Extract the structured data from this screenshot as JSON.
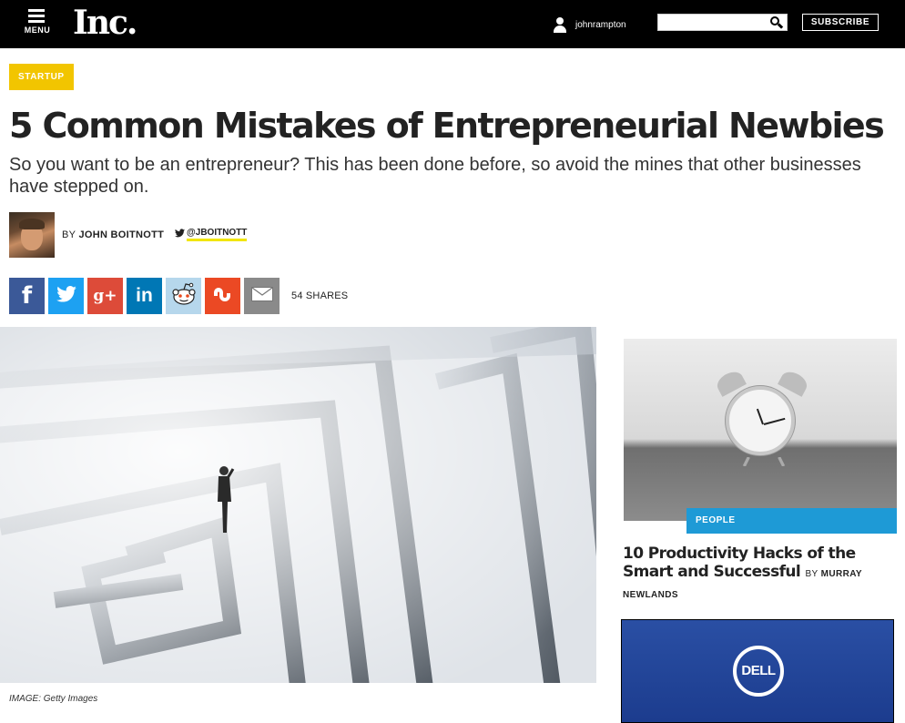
{
  "header": {
    "menu_label": "MENU",
    "logo_text": "Inc.",
    "username": "johnrampton",
    "search_placeholder": "",
    "subscribe_label": "SUBSCRIBE"
  },
  "article": {
    "category": "STARTUP",
    "headline": "5 Common Mistakes of Entrepreneurial Newbies",
    "dek": "So you want to be an entrepreneur? This has been done before, so avoid the mines that other businesses have stepped on.",
    "byline_prefix": "BY ",
    "author": "JOHN BOITNOTT",
    "twitter_handle": "@JBOITNOTT",
    "share_count": "54 SHARES",
    "image_caption": "IMAGE: Getty Images"
  },
  "share_buttons": [
    {
      "name": "facebook",
      "glyph": "f"
    },
    {
      "name": "twitter",
      "glyph": "🐦"
    },
    {
      "name": "google-plus",
      "glyph": "g+"
    },
    {
      "name": "linkedin",
      "glyph": "in"
    },
    {
      "name": "reddit",
      "glyph": ""
    },
    {
      "name": "stumbleupon",
      "glyph": ""
    },
    {
      "name": "email",
      "glyph": ""
    }
  ],
  "sidebar": {
    "story_tag": "PEOPLE",
    "story_headline": "10 Productivity Hacks of the Smart and Successful",
    "story_byline_prefix": "BY ",
    "story_author": "MURRAY NEWLANDS",
    "ad_brand": "DELL"
  },
  "colors": {
    "topbar": "#000000",
    "category_tag": "#f2c500",
    "people_tag": "#1e9ad6",
    "twitter_underline": "#f2e600",
    "ad_background": "#2a4fa4"
  }
}
